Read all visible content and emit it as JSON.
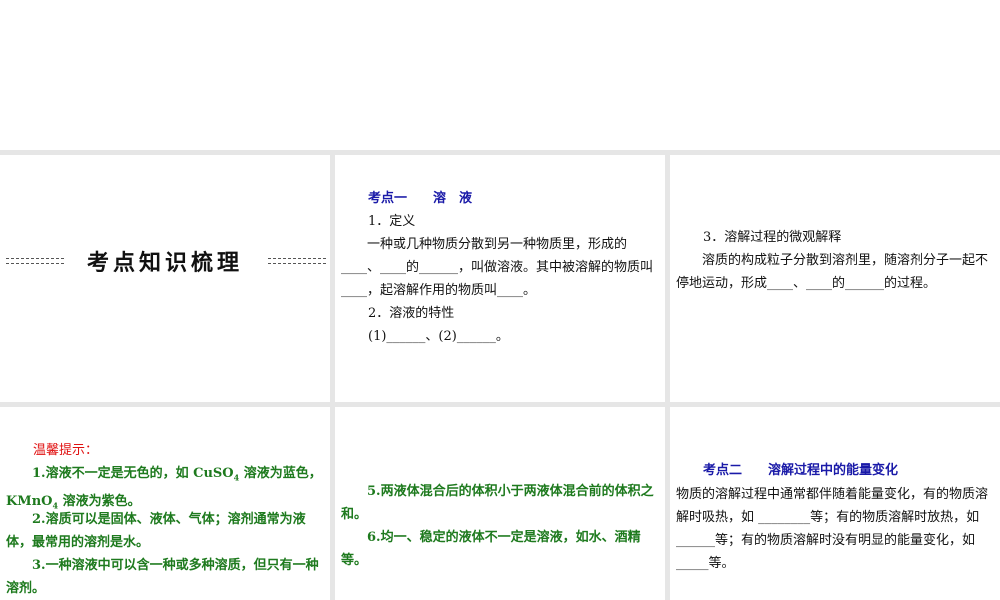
{
  "slide1": {
    "title": "考点知识梳理"
  },
  "slide2": {
    "heading": "考点一　　溶　液",
    "item1": "1．定义",
    "def": "一种或几种物质分散到另一种物质里，形成的____、____的______，叫做溶液。其中被溶解的物质叫____，起溶解作用的物质叫____。",
    "item2": "2．溶液的特性",
    "blanks": "(1)______、(2)______。"
  },
  "slide3": {
    "item3": "3．溶解过程的微观解释",
    "text": "溶质的构成粒子分散到溶剂里，随溶剂分子一起不停地运动，形成____、____的______的过程。"
  },
  "slide4": {
    "label": "温馨提示：",
    "tip1a": "1.溶液不一定是无色的，如 CuSO",
    "tip1b": "4",
    "tip1c": " 溶液为蓝色，KMnO",
    "tip1d": "4",
    "tip1e": " 溶液为紫色。",
    "tip2": "2.溶质可以是固体、液体、气体；溶剂通常为液体，最常用的溶剂是水。",
    "tip3": "3.一种溶液中可以含一种或多种溶质，但只有一种溶剂。"
  },
  "slide5": {
    "tip5": "5.两液体混合后的体积小于两液体混合前的体积之和。",
    "tip6": "6.均一、稳定的液体不一定是溶液，如水、酒精等。"
  },
  "slide6": {
    "heading": "考点二　　溶解过程中的能量变化",
    "text": "物质的溶解过程中通常都伴随着能量变化，有的物质溶解时吸热，如 ________等；有的物质溶解时放热，如 ______等；有的物质溶解时没有明显的能量变化，如 _____等。"
  },
  "colors": {
    "blue": "#1a1aa8",
    "green": "#1e7a1e",
    "red": "#e01010",
    "gap": "#e6e6e6"
  }
}
